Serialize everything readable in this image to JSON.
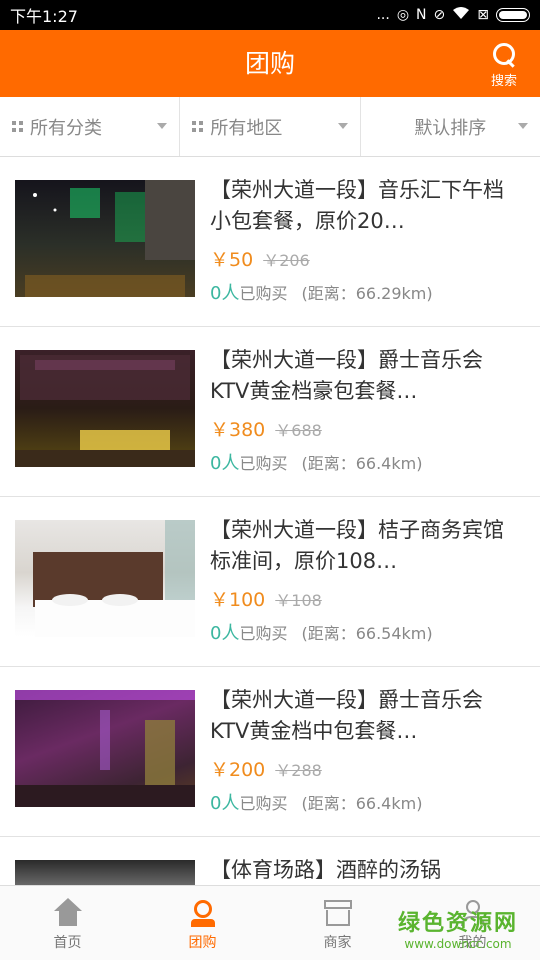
{
  "status_bar": {
    "time": "下午1:27",
    "icons": [
      "...",
      "◎",
      "N",
      "⊘",
      "wifi",
      "⊠"
    ]
  },
  "header": {
    "title": "团购",
    "search_label": "搜索"
  },
  "filters": [
    {
      "label": "所有分类"
    },
    {
      "label": "所有地区"
    },
    {
      "label": "默认排序"
    }
  ],
  "deals": [
    {
      "name": "【荣州大道一段】音乐汇下午档小包套餐，原价20…",
      "price": "￥50",
      "old_price": "￥206",
      "bought_count": "0人",
      "bought_label": "已购买",
      "distance": "(距离：66.29km)"
    },
    {
      "name": "【荣州大道一段】爵士音乐会KTV黄金档豪包套餐…",
      "price": "￥380",
      "old_price": "￥688",
      "bought_count": "0人",
      "bought_label": "已购买",
      "distance": "(距离：66.4km)"
    },
    {
      "name": "【荣州大道一段】桔子商务宾馆标准间，原价108…",
      "price": "￥100",
      "old_price": "￥108",
      "bought_count": "0人",
      "bought_label": "已购买",
      "distance": "(距离：66.54km)"
    },
    {
      "name": "【荣州大道一段】爵士音乐会KTV黄金档中包套餐…",
      "price": "￥200",
      "old_price": "￥288",
      "bought_count": "0人",
      "bought_label": "已购买",
      "distance": "(距离：66.4km)"
    },
    {
      "name": "【体育场路】酒醉的汤锅",
      "price": "",
      "old_price": "",
      "bought_count": "",
      "bought_label": "",
      "distance": ""
    }
  ],
  "tabs": [
    {
      "label": "首页",
      "icon": "home-icon"
    },
    {
      "label": "团购",
      "icon": "group-icon",
      "active": true
    },
    {
      "label": "商家",
      "icon": "shop-icon"
    },
    {
      "label": "我的",
      "icon": "me-icon"
    }
  ],
  "watermark": {
    "title": "绿色资源网",
    "url": "www.downcc.com"
  },
  "colors": {
    "accent": "#ff6a00",
    "price": "#f08c1e",
    "count": "#3cb7a0"
  }
}
